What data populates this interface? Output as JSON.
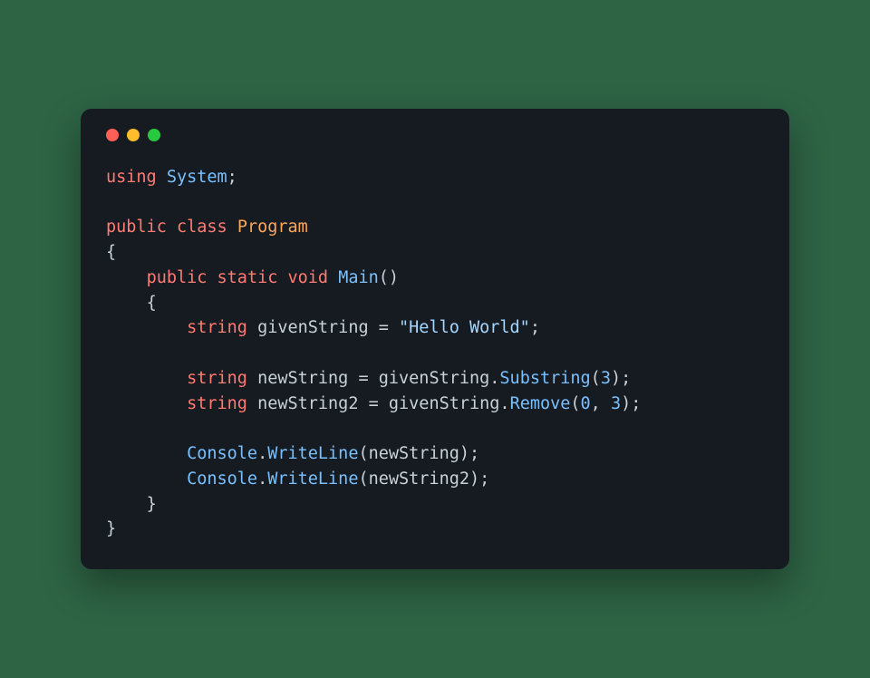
{
  "window": {
    "traffic_lights": [
      "close",
      "minimize",
      "zoom"
    ]
  },
  "code": {
    "t_using": "using",
    "t_system": "System",
    "t_public": "public",
    "t_class": "class",
    "t_program": "Program",
    "t_static": "static",
    "t_void": "void",
    "t_main": "Main",
    "t_string_kw": "string",
    "v_givenString": "givenString",
    "lit_hello": "\"Hello World\"",
    "v_newString": "newString",
    "v_newString2": "newString2",
    "m_substring": "Substring",
    "m_remove": "Remove",
    "n_3": "3",
    "n_0": "0",
    "t_console": "Console",
    "m_writeline": "WriteLine",
    "semi": ";",
    "lbrace": "{",
    "rbrace": "}",
    "lparen": "(",
    "rparen": ")",
    "dot": ".",
    "comma": ",",
    "sp": " ",
    "eq": "=",
    "indent1": "    ",
    "indent2": "        "
  }
}
